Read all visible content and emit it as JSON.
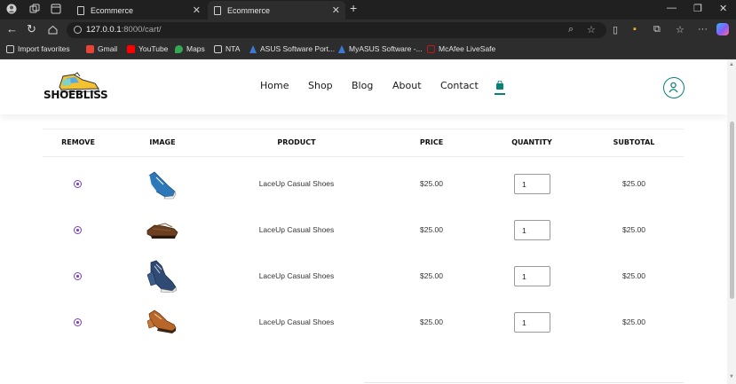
{
  "browser": {
    "tabs": [
      {
        "title": "Ecommerce",
        "active": false
      },
      {
        "title": "Ecommerce",
        "active": true
      }
    ],
    "url_host": "127.0.0.1",
    "url_path": ":8000/cart/",
    "favorites": [
      "Import favorites",
      "Gmail",
      "YouTube",
      "Maps",
      "NTA",
      "ASUS Software Port...",
      "MyASUS Software -...",
      "McAfee LiveSafe"
    ]
  },
  "site": {
    "logo_text": "SHOEBLISS",
    "nav": [
      "Home",
      "Shop",
      "Blog",
      "About",
      "Contact"
    ],
    "accent_color": "#088178"
  },
  "cart": {
    "headers": [
      "REMOVE",
      "IMAGE",
      "PRODUCT",
      "PRICE",
      "QUANTITY",
      "SUBTOTAL"
    ],
    "rows": [
      {
        "image": "blue-sneaker",
        "product": "LaceUp Casual Shoes",
        "price": "$25.00",
        "quantity": "1",
        "subtotal": "$25.00"
      },
      {
        "image": "brown-loafer",
        "product": "LaceUp Casual Shoes",
        "price": "$25.00",
        "quantity": "1",
        "subtotal": "$25.00"
      },
      {
        "image": "navy-sneaker",
        "product": "LaceUp Casual Shoes",
        "price": "$25.00",
        "quantity": "1",
        "subtotal": "$25.00"
      },
      {
        "image": "tan-oxford",
        "product": "LaceUp Casual Shoes",
        "price": "$25.00",
        "quantity": "1",
        "subtotal": "$25.00"
      }
    ]
  }
}
